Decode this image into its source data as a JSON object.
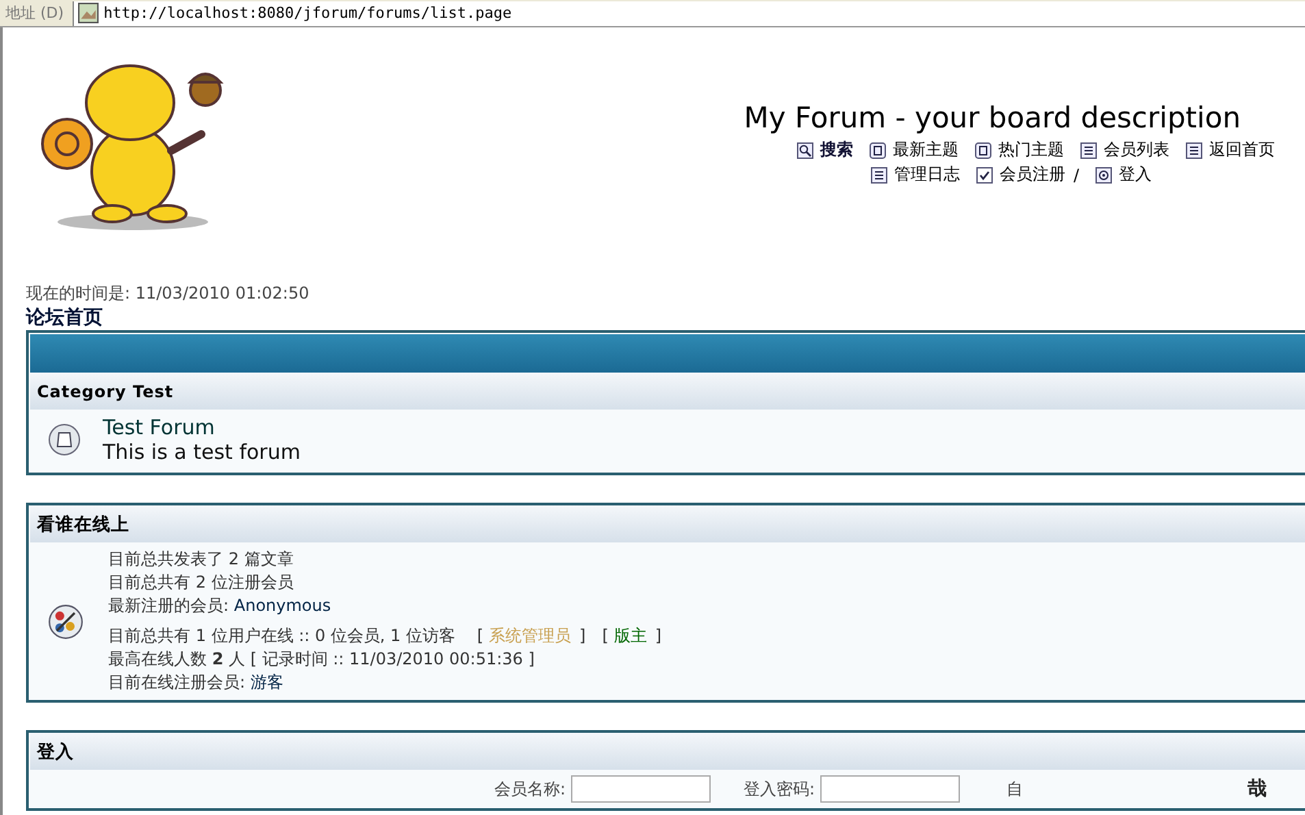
{
  "address_bar": {
    "label": "地址 (D)",
    "url": "http://localhost:8080/jforum/forums/list.page"
  },
  "header": {
    "title": "My Forum - your board description",
    "nav_rows": [
      [
        {
          "label": "搜索",
          "kind": "search",
          "bold": true
        },
        {
          "label": "最新主题",
          "kind": "topics",
          "bold": false
        },
        {
          "label": "热门主题",
          "kind": "topics",
          "bold": false
        },
        {
          "label": "会员列表",
          "kind": "page",
          "bold": false
        },
        {
          "label": "返回首页",
          "kind": "page",
          "bold": false
        }
      ],
      [
        {
          "label": "管理日志",
          "kind": "page",
          "bold": false
        },
        {
          "label": "会员注册",
          "kind": "register",
          "bold": false,
          "separator": "/"
        },
        {
          "label": "登入",
          "kind": "login",
          "bold": false
        }
      ]
    ]
  },
  "current_time": "现在的时间是: 11/03/2010 01:02:50",
  "breadcrumb": "论坛首页",
  "category": {
    "name": "Category Test",
    "forums": [
      {
        "name": "Test Forum",
        "description": "This is a test forum"
      }
    ]
  },
  "who_online": {
    "title": "看谁在线上",
    "stats": [
      "目前总共发表了 2 篇文章",
      "目前总共有 2 位注册会员"
    ],
    "newest_label": "最新注册的会员:",
    "newest_user": "Anonymous",
    "online_line": "目前总共有 1 位用户在线 :: 0 位会员, 1 位访客",
    "legend": [
      {
        "open": "[",
        "label": "系统管理员",
        "close": "]",
        "color": "#c8a050"
      },
      {
        "open": "[",
        "label": "版主",
        "close": "]",
        "color": "#006600"
      }
    ],
    "record_line": "最高在线人数 **2** 人 [ 记录时间 :: 11/03/2010 00:51:36 ]",
    "registered_label": "目前在线注册会员:",
    "registered_user": "游客"
  },
  "login": {
    "title": "登入",
    "fields": [
      {
        "label": "会员名称:"
      },
      {
        "label": "登入密码:"
      }
    ],
    "fragment_left": "自",
    "fragment_right": "哉"
  }
}
